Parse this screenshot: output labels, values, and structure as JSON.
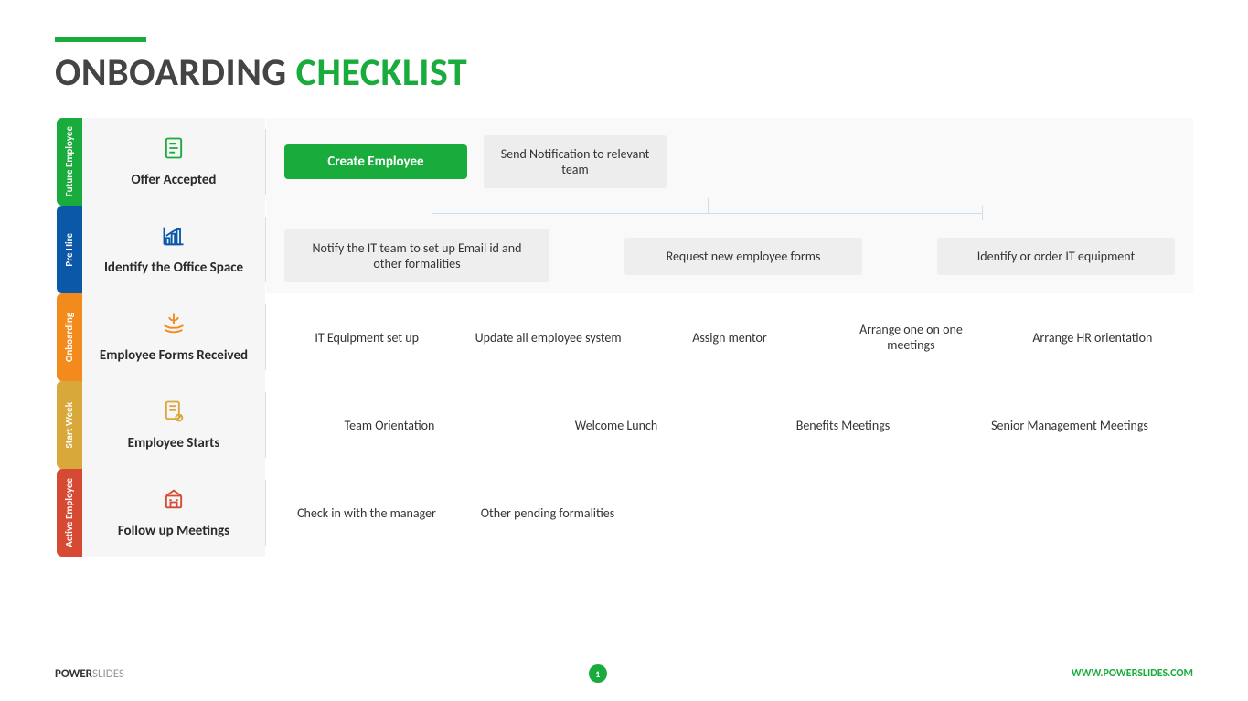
{
  "title_part1": "ONBOARDING ",
  "title_part2": "CHECKLIST",
  "rows": [
    {
      "tab": "Future Employee",
      "core": "Offer Accepted",
      "items": {
        "btn": "Create Employee",
        "box": "Send Notification to relevant team"
      }
    },
    {
      "tab": "Pre Hire",
      "core": "Identify the Office Space",
      "items": {
        "a": "Notify the IT team to set up Email id and other formalities",
        "b": "Request new employee forms",
        "c": "Identify or order IT equipment"
      }
    },
    {
      "tab": "Onboarding",
      "core": "Employee Forms Received",
      "items": {
        "a": "IT Equipment set up",
        "b": "Update all employee system",
        "c": "Assign mentor",
        "d": "Arrange one on one meetings",
        "e": "Arrange HR orientation"
      }
    },
    {
      "tab": "Start Week",
      "core": "Employee Starts",
      "items": {
        "a": "Team Orientation",
        "b": "Welcome Lunch",
        "c": "Benefits Meetings",
        "d": "Senior Management Meetings"
      }
    },
    {
      "tab": "Active Employee",
      "core": "Follow up Meetings",
      "items": {
        "a": "Check in with the manager",
        "b": "Other pending formalities"
      }
    }
  ],
  "footer": {
    "brand1": "POWER",
    "brand2": "SLIDES",
    "page": "1",
    "url": "WWW.POWERSLIDES.COM"
  }
}
